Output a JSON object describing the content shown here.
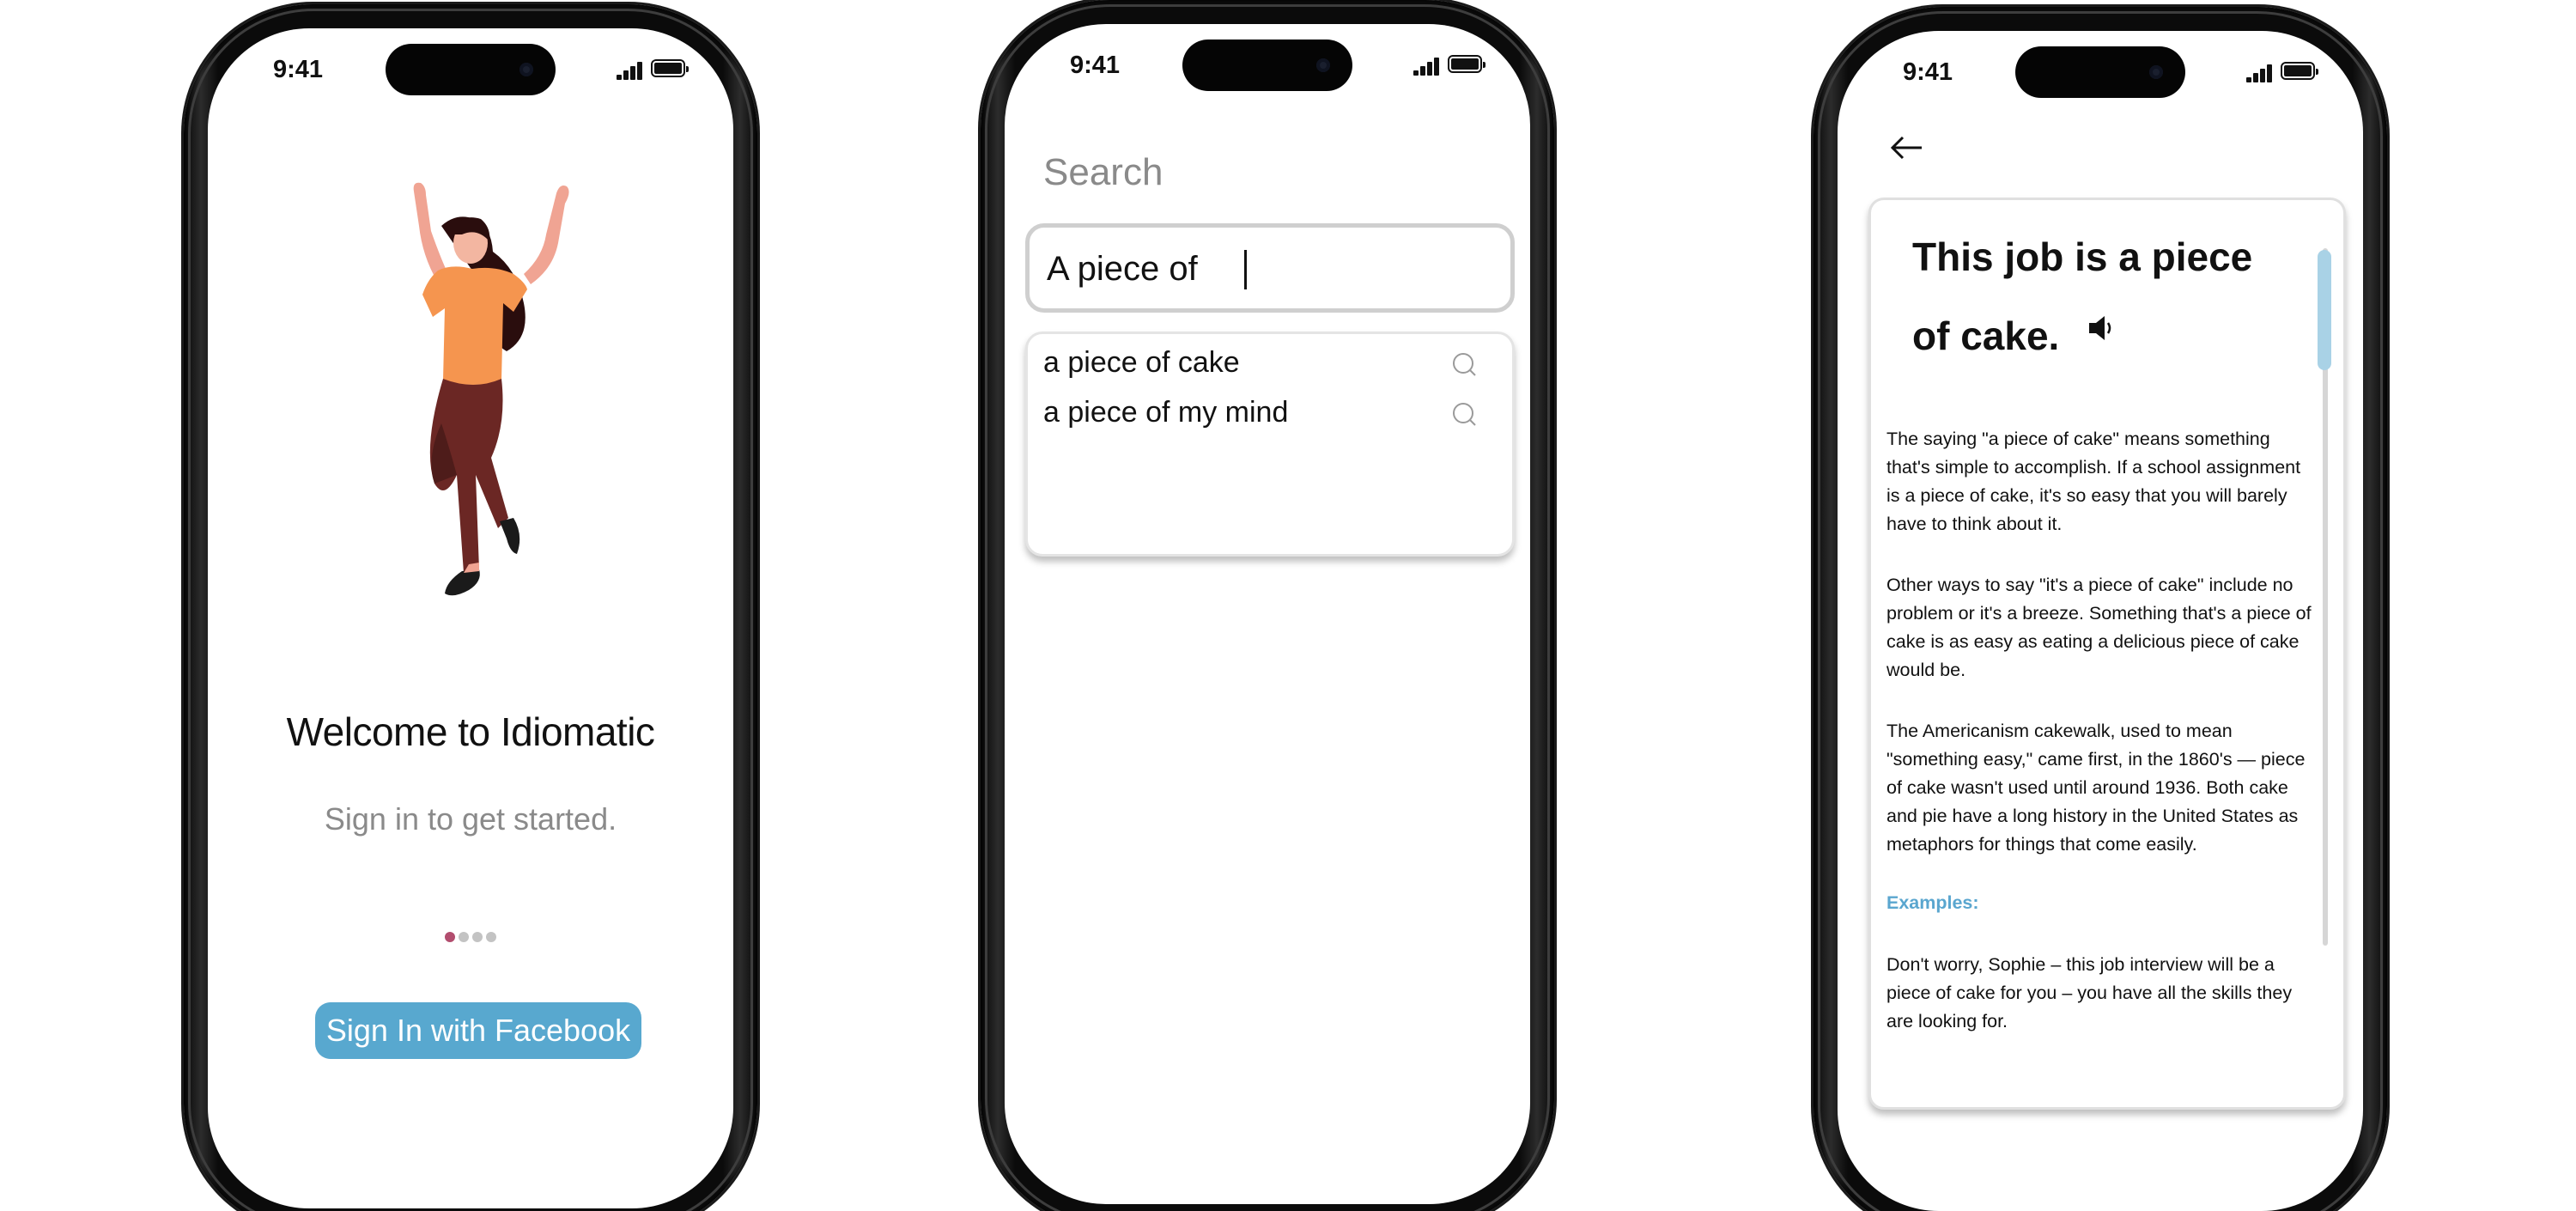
{
  "status": {
    "time": "9:41"
  },
  "onboarding": {
    "title": "Welcome to Idiomatic",
    "subtitle": "Sign in to get started.",
    "pager": {
      "total": 4,
      "active": 1
    },
    "sign_in_label": "Sign In with Facebook",
    "accent_color": "#58a8cf"
  },
  "search": {
    "heading": "Search",
    "query": "A piece of",
    "suggestions": [
      {
        "label": "a piece of cake",
        "icon": "search-icon"
      },
      {
        "label": "a piece of my mind",
        "icon": "search-icon"
      }
    ]
  },
  "detail": {
    "back_icon": "arrow-left-icon",
    "title": "This job is a piece of cake.",
    "speaker_icon": "speaker-icon",
    "paragraphs": [
      "The saying \"a piece of cake\" means something that's simple to accomplish. If a school assignment is a piece of cake, it's so easy that you will barely have to think about it.",
      "Other ways to say \"it's a piece of cake\" include no problem or it's a breeze. Something that's a piece of cake is as easy as eating a delicious piece of cake would be.",
      "The Americanism cakewalk, used to mean \"something easy,\" came first, in the 1860's — piece of cake wasn't used until around 1936. Both cake and pie have a long history in the United States as metaphors for things that come easily."
    ],
    "examples_label": "Examples:",
    "example": "Don't worry, Sophie – this job interview will be a piece of cake for you – you have all the skills they are looking for.",
    "examples_color": "#5aa6cf"
  }
}
